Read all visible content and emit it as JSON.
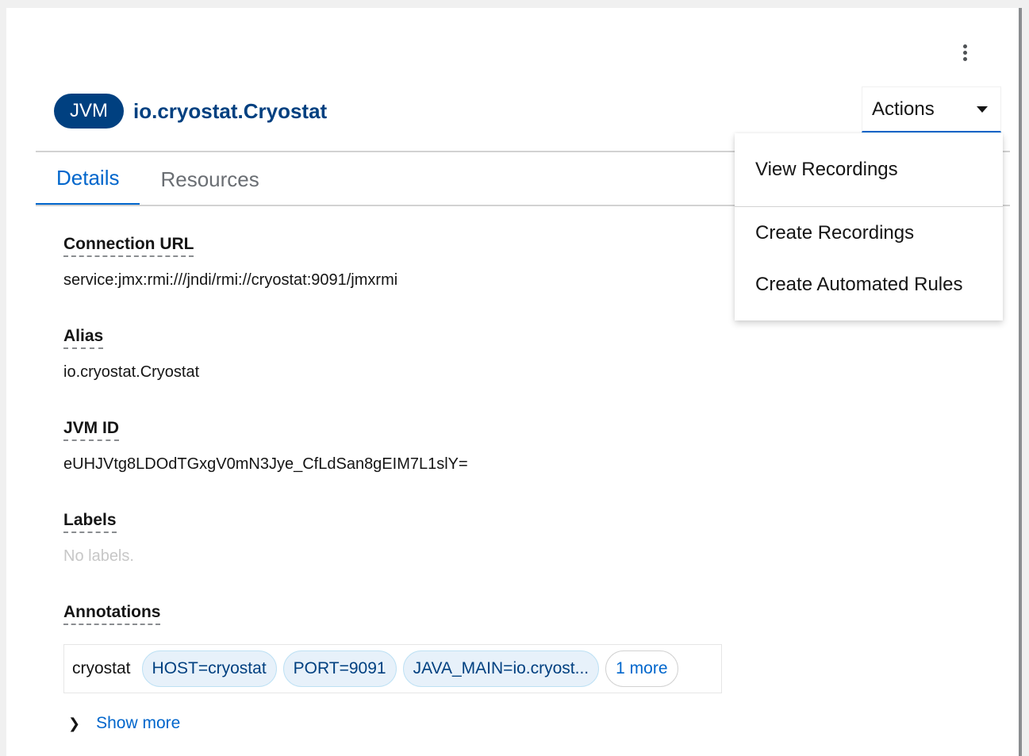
{
  "header": {
    "badge": "JVM",
    "target_name": "io.cryostat.Cryostat",
    "actions_label": "Actions"
  },
  "tabs": [
    {
      "label": "Details",
      "active": true
    },
    {
      "label": "Resources",
      "active": false
    }
  ],
  "details": {
    "connection_url_label": "Connection URL",
    "connection_url_value": "service:jmx:rmi:///jndi/rmi://cryostat:9091/jmxrmi",
    "alias_label": "Alias",
    "alias_value": "io.cryostat.Cryostat",
    "jvm_id_label": "JVM ID",
    "jvm_id_value": "eUHJVtg8LDOdTGxgV0mN3Jye_CfLdSan8gEIM7L1slY=",
    "labels_label": "Labels",
    "labels_value": "No labels.",
    "annotations_label": "Annotations",
    "annotation_category": "cryostat",
    "annotation_chips": [
      "HOST=cryostat",
      "PORT=9091",
      "JAVA_MAIN=io.cryost..."
    ],
    "more_chip": "1 more",
    "show_more": "Show more"
  },
  "actions_menu": {
    "items": [
      "View Recordings",
      "Create Recordings",
      "Create Automated Rules"
    ]
  },
  "colors": {
    "accent": "#06c",
    "badge_bg": "#004080"
  }
}
